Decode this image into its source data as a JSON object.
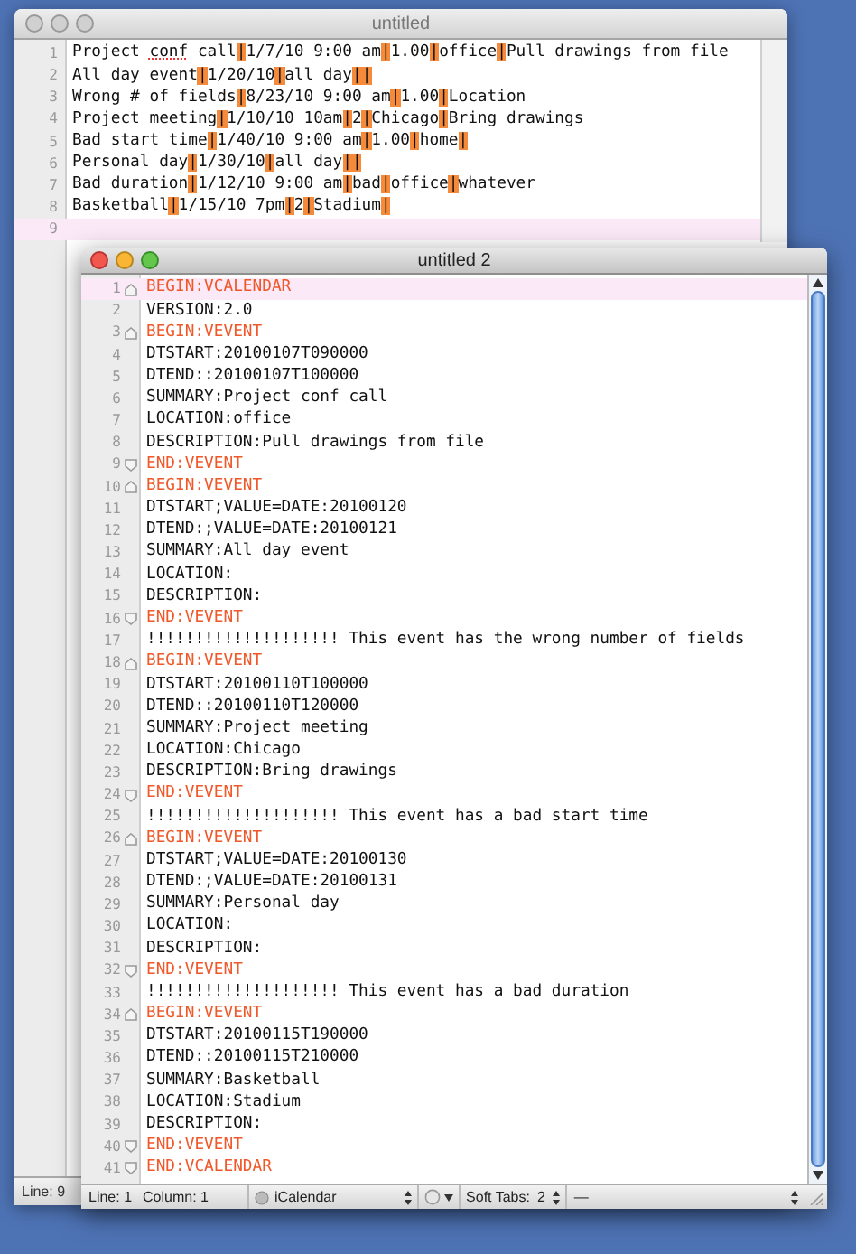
{
  "back_window": {
    "title": "untitled",
    "active": false,
    "lines": [
      {
        "number": "1",
        "selected": false,
        "segments": [
          {
            "kind": "text",
            "text": "Project "
          },
          {
            "kind": "misspelled",
            "text": "conf"
          },
          {
            "kind": "text",
            "text": " call"
          },
          {
            "kind": "pipe",
            "text": "|"
          },
          {
            "kind": "text",
            "text": "1/7/10 9:00 am"
          },
          {
            "kind": "pipe",
            "text": "|"
          },
          {
            "kind": "text",
            "text": "1.00"
          },
          {
            "kind": "pipe",
            "text": "|"
          },
          {
            "kind": "text",
            "text": "office"
          },
          {
            "kind": "pipe",
            "text": "|"
          },
          {
            "kind": "text",
            "text": "Pull drawings from file"
          }
        ]
      },
      {
        "number": "2",
        "selected": false,
        "segments": [
          {
            "kind": "text",
            "text": "All day event"
          },
          {
            "kind": "pipe",
            "text": "|"
          },
          {
            "kind": "text",
            "text": "1/20/10"
          },
          {
            "kind": "pipe",
            "text": "|"
          },
          {
            "kind": "text",
            "text": "all day"
          },
          {
            "kind": "pipe",
            "text": "|"
          },
          {
            "kind": "pipe",
            "text": "|"
          }
        ]
      },
      {
        "number": "3",
        "selected": false,
        "segments": [
          {
            "kind": "text",
            "text": "Wrong # of fields"
          },
          {
            "kind": "pipe",
            "text": "|"
          },
          {
            "kind": "text",
            "text": "8/23/10 9:00 am"
          },
          {
            "kind": "pipe",
            "text": "|"
          },
          {
            "kind": "text",
            "text": "1.00"
          },
          {
            "kind": "pipe",
            "text": "|"
          },
          {
            "kind": "text",
            "text": "Location"
          }
        ]
      },
      {
        "number": "4",
        "selected": false,
        "segments": [
          {
            "kind": "text",
            "text": "Project meeting"
          },
          {
            "kind": "pipe",
            "text": "|"
          },
          {
            "kind": "text",
            "text": "1/10/10 10am"
          },
          {
            "kind": "pipe",
            "text": "|"
          },
          {
            "kind": "text",
            "text": "2"
          },
          {
            "kind": "pipe",
            "text": "|"
          },
          {
            "kind": "text",
            "text": "Chicago"
          },
          {
            "kind": "pipe",
            "text": "|"
          },
          {
            "kind": "text",
            "text": "Bring drawings"
          }
        ]
      },
      {
        "number": "5",
        "selected": false,
        "segments": [
          {
            "kind": "text",
            "text": "Bad start time"
          },
          {
            "kind": "pipe",
            "text": "|"
          },
          {
            "kind": "text",
            "text": "1/40/10 9:00 am"
          },
          {
            "kind": "pipe",
            "text": "|"
          },
          {
            "kind": "text",
            "text": "1.00"
          },
          {
            "kind": "pipe",
            "text": "|"
          },
          {
            "kind": "text",
            "text": "home"
          },
          {
            "kind": "pipe",
            "text": "|"
          }
        ]
      },
      {
        "number": "6",
        "selected": false,
        "segments": [
          {
            "kind": "text",
            "text": "Personal day"
          },
          {
            "kind": "pipe",
            "text": "|"
          },
          {
            "kind": "text",
            "text": "1/30/10"
          },
          {
            "kind": "pipe",
            "text": "|"
          },
          {
            "kind": "text",
            "text": "all day"
          },
          {
            "kind": "pipe",
            "text": "|"
          },
          {
            "kind": "pipe",
            "text": "|"
          }
        ]
      },
      {
        "number": "7",
        "selected": false,
        "segments": [
          {
            "kind": "text",
            "text": "Bad duration"
          },
          {
            "kind": "pipe",
            "text": "|"
          },
          {
            "kind": "text",
            "text": "1/12/10 9:00 am"
          },
          {
            "kind": "pipe",
            "text": "|"
          },
          {
            "kind": "text",
            "text": "bad"
          },
          {
            "kind": "pipe",
            "text": "|"
          },
          {
            "kind": "text",
            "text": "office"
          },
          {
            "kind": "pipe",
            "text": "|"
          },
          {
            "kind": "text",
            "text": "whatever"
          }
        ]
      },
      {
        "number": "8",
        "selected": false,
        "segments": [
          {
            "kind": "text",
            "text": "Basketball"
          },
          {
            "kind": "pipe",
            "text": "|"
          },
          {
            "kind": "text",
            "text": "1/15/10 7pm"
          },
          {
            "kind": "pipe",
            "text": "|"
          },
          {
            "kind": "text",
            "text": "2"
          },
          {
            "kind": "pipe",
            "text": "|"
          },
          {
            "kind": "text",
            "text": "Stadium"
          },
          {
            "kind": "pipe",
            "text": "|"
          }
        ]
      },
      {
        "number": "9",
        "selected": true
      }
    ],
    "status_bar": {
      "line": "Line: 9"
    }
  },
  "front_window": {
    "title": "untitled 2",
    "active": true,
    "lines": [
      {
        "number": "1",
        "kind": "begin",
        "selected": true,
        "text": "BEGIN:VCALENDAR"
      },
      {
        "number": "2",
        "kind": "plain",
        "selected": false,
        "text": "VERSION:2.0"
      },
      {
        "number": "3",
        "kind": "begin",
        "selected": false,
        "text": "BEGIN:VEVENT"
      },
      {
        "number": "4",
        "kind": "plain",
        "selected": false,
        "text": "DTSTART:20100107T090000"
      },
      {
        "number": "5",
        "kind": "plain",
        "selected": false,
        "text": "DTEND::20100107T100000"
      },
      {
        "number": "6",
        "kind": "plain",
        "selected": false,
        "text": "SUMMARY:Project conf call"
      },
      {
        "number": "7",
        "kind": "plain",
        "selected": false,
        "text": "LOCATION:office"
      },
      {
        "number": "8",
        "kind": "plain",
        "selected": false,
        "text": "DESCRIPTION:Pull drawings from file"
      },
      {
        "number": "9",
        "kind": "end",
        "selected": false,
        "text": "END:VEVENT"
      },
      {
        "number": "10",
        "kind": "begin",
        "selected": false,
        "text": "BEGIN:VEVENT"
      },
      {
        "number": "11",
        "kind": "plain",
        "selected": false,
        "text": "DTSTART;VALUE=DATE:20100120"
      },
      {
        "number": "12",
        "kind": "plain",
        "selected": false,
        "text": "DTEND:;VALUE=DATE:20100121"
      },
      {
        "number": "13",
        "kind": "plain",
        "selected": false,
        "text": "SUMMARY:All day event"
      },
      {
        "number": "14",
        "kind": "plain",
        "selected": false,
        "text": "LOCATION:"
      },
      {
        "number": "15",
        "kind": "plain",
        "selected": false,
        "text": "DESCRIPTION:"
      },
      {
        "number": "16",
        "kind": "end",
        "selected": false,
        "text": "END:VEVENT"
      },
      {
        "number": "17",
        "kind": "plain",
        "selected": false,
        "text": "!!!!!!!!!!!!!!!!!!!! This event has the wrong number of fields"
      },
      {
        "number": "18",
        "kind": "begin",
        "selected": false,
        "text": "BEGIN:VEVENT"
      },
      {
        "number": "19",
        "kind": "plain",
        "selected": false,
        "text": "DTSTART:20100110T100000"
      },
      {
        "number": "20",
        "kind": "plain",
        "selected": false,
        "text": "DTEND::20100110T120000"
      },
      {
        "number": "21",
        "kind": "plain",
        "selected": false,
        "text": "SUMMARY:Project meeting"
      },
      {
        "number": "22",
        "kind": "plain",
        "selected": false,
        "text": "LOCATION:Chicago"
      },
      {
        "number": "23",
        "kind": "plain",
        "selected": false,
        "text": "DESCRIPTION:Bring drawings"
      },
      {
        "number": "24",
        "kind": "end",
        "selected": false,
        "text": "END:VEVENT"
      },
      {
        "number": "25",
        "kind": "plain",
        "selected": false,
        "text": "!!!!!!!!!!!!!!!!!!!! This event has a bad start time"
      },
      {
        "number": "26",
        "kind": "begin",
        "selected": false,
        "text": "BEGIN:VEVENT"
      },
      {
        "number": "27",
        "kind": "plain",
        "selected": false,
        "text": "DTSTART;VALUE=DATE:20100130"
      },
      {
        "number": "28",
        "kind": "plain",
        "selected": false,
        "text": "DTEND:;VALUE=DATE:20100131"
      },
      {
        "number": "29",
        "kind": "plain",
        "selected": false,
        "text": "SUMMARY:Personal day"
      },
      {
        "number": "30",
        "kind": "plain",
        "selected": false,
        "text": "LOCATION:"
      },
      {
        "number": "31",
        "kind": "plain",
        "selected": false,
        "text": "DESCRIPTION:"
      },
      {
        "number": "32",
        "kind": "end",
        "selected": false,
        "text": "END:VEVENT"
      },
      {
        "number": "33",
        "kind": "plain",
        "selected": false,
        "text": "!!!!!!!!!!!!!!!!!!!! This event has a bad duration"
      },
      {
        "number": "34",
        "kind": "begin",
        "selected": false,
        "text": "BEGIN:VEVENT"
      },
      {
        "number": "35",
        "kind": "plain",
        "selected": false,
        "text": "DTSTART:20100115T190000"
      },
      {
        "number": "36",
        "kind": "plain",
        "selected": false,
        "text": "DTEND::20100115T210000"
      },
      {
        "number": "37",
        "kind": "plain",
        "selected": false,
        "text": "SUMMARY:Basketball"
      },
      {
        "number": "38",
        "kind": "plain",
        "selected": false,
        "text": "LOCATION:Stadium"
      },
      {
        "number": "39",
        "kind": "plain",
        "selected": false,
        "text": "DESCRIPTION:"
      },
      {
        "number": "40",
        "kind": "end",
        "selected": false,
        "text": "END:VEVENT"
      },
      {
        "number": "41",
        "kind": "end",
        "selected": false,
        "text": "END:VCALENDAR"
      }
    ],
    "status_bar": {
      "line": "Line: 1",
      "column": "Column: 1",
      "language": "iCalendar",
      "tabs": "Soft Tabs:",
      "tab_size": "2",
      "symbol": "—"
    }
  }
}
